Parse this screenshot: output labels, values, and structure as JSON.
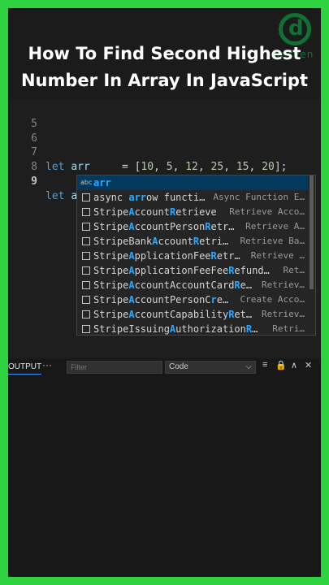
{
  "logo": {
    "glyph": "d",
    "brand": "desven"
  },
  "title": {
    "line1": "How To Find Second Highest",
    "line2": "Number In Array In JavaScript"
  },
  "editor": {
    "lines": [
      {
        "number": "5"
      },
      {
        "number": "6"
      },
      {
        "number": "7",
        "kw": "let",
        "name": "arr",
        "eq": "=",
        "open": "[",
        "values": [
          "10",
          "5",
          "12",
          "25",
          "15",
          "20"
        ],
        "sep": ", ",
        "close": "];"
      },
      {
        "number": "8"
      },
      {
        "number": "9",
        "kw": "let",
        "name": "arr"
      }
    ]
  },
  "suggest": {
    "items": [
      {
        "pre": "",
        "hl1": "arr",
        "mid": "",
        "hl2": "",
        "post": "",
        "detail": "",
        "icon": "abc-icon",
        "icon_text": "abc"
      },
      {
        "pre": "async ",
        "hl1": "arr",
        "mid": "ow functi…",
        "hl2": "",
        "post": "",
        "detail": "Async Function E…",
        "icon": "snippet-icon"
      },
      {
        "pre": "Stripe",
        "hl1": "A",
        "mid": "ccount",
        "hl2": "R",
        "post": "etrieve",
        "detail": "Retrieve Acco…",
        "icon": "snippet-icon"
      },
      {
        "pre": "Stripe",
        "hl1": "A",
        "mid": "ccountPerson",
        "hl2": "R",
        "post": "etr…",
        "detail": "Retrieve A…",
        "icon": "snippet-icon"
      },
      {
        "pre": "StripeBank",
        "hl1": "A",
        "mid": "ccount",
        "hl2": "R",
        "post": "etri…",
        "detail": "Retrieve Ba…",
        "icon": "snippet-icon"
      },
      {
        "pre": "Stripe",
        "hl1": "A",
        "mid": "pplicationFee",
        "hl2": "R",
        "post": "etr…",
        "detail": "Retrieve …",
        "icon": "snippet-icon"
      },
      {
        "pre": "Stripe",
        "hl1": "A",
        "mid": "pplicationFeeFee",
        "hl2": "R",
        "post": "efund…",
        "detail": "Ret…",
        "icon": "snippet-icon"
      },
      {
        "pre": "Stripe",
        "hl1": "A",
        "mid": "ccountAccountCard",
        "hl2": "R",
        "post": "e…",
        "detail": "Retriev…",
        "icon": "snippet-icon"
      },
      {
        "pre": "Stripe",
        "hl1": "A",
        "mid": "ccountPersonC",
        "hl2": "r",
        "post": "e…",
        "detail": "Create Acco…",
        "icon": "snippet-icon"
      },
      {
        "pre": "Stripe",
        "hl1": "A",
        "mid": "ccountCapability",
        "hl2": "R",
        "post": "et…",
        "detail": "Retriev…",
        "icon": "snippet-icon"
      },
      {
        "pre": "StripeIssuing",
        "hl1": "A",
        "mid": "uthorization",
        "hl2": "R",
        "post": "…",
        "detail": "Retri…",
        "icon": "snippet-icon"
      }
    ]
  },
  "panel": {
    "tab": "OUTPUT",
    "more": "···",
    "filter_placeholder": "Filter",
    "select_value": "Code",
    "chevron": "⌵",
    "icons": [
      {
        "name": "list-filter-icon",
        "glyph": "≡"
      },
      {
        "name": "lock-icon",
        "glyph": "🔒"
      },
      {
        "name": "chevron-up-icon",
        "glyph": "∧"
      },
      {
        "name": "close-icon",
        "glyph": "✕"
      }
    ]
  }
}
